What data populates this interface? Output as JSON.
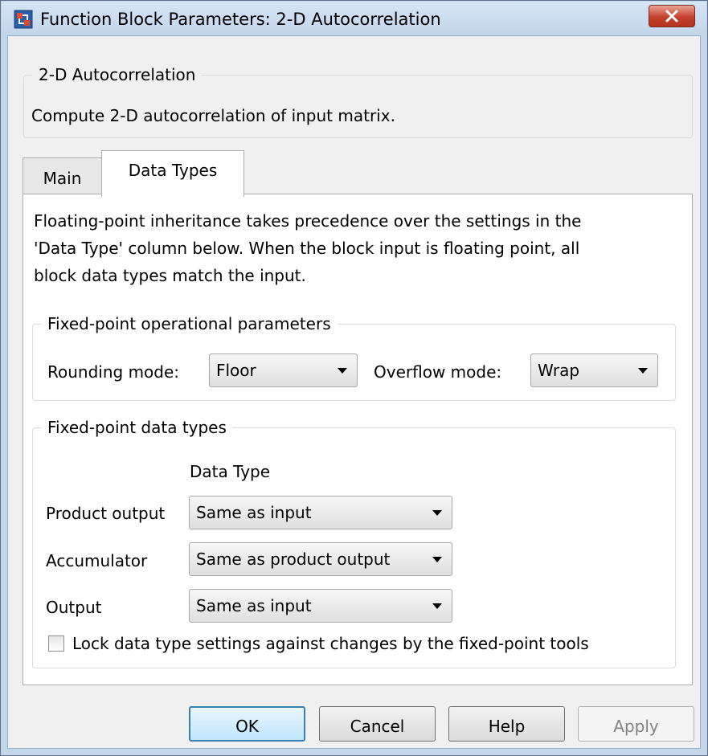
{
  "window": {
    "title": "Function Block Parameters: 2-D Autocorrelation"
  },
  "description": {
    "group_title": "2-D Autocorrelation",
    "text": "Compute 2-D autocorrelation of input matrix."
  },
  "tabs": [
    {
      "label": "Main",
      "selected": false
    },
    {
      "label": "Data Types",
      "selected": true
    }
  ],
  "data_types": {
    "intro_lines": [
      "Floating-point inheritance takes precedence over the settings in the",
      "'Data Type' column below. When the block input is floating point, all",
      "block data types match the input."
    ],
    "operational": {
      "group_title": "Fixed-point operational parameters",
      "rounding_label": "Rounding mode:",
      "rounding_value": "Floor",
      "overflow_label": "Overflow mode:",
      "overflow_value": "Wrap"
    },
    "fixed_point_types": {
      "group_title": "Fixed-point data types",
      "column_header": "Data Type",
      "rows": [
        {
          "label": "Product output",
          "value": "Same as input"
        },
        {
          "label": "Accumulator",
          "value": "Same as product output"
        },
        {
          "label": "Output",
          "value": "Same as input"
        }
      ],
      "lock_checkbox_label": "Lock data type settings against changes by the fixed-point tools",
      "lock_checked": false
    }
  },
  "buttons": {
    "ok": "OK",
    "cancel": "Cancel",
    "help": "Help",
    "apply": "Apply",
    "apply_enabled": false
  },
  "colors": {
    "title_bar": "#c4d6ea",
    "close_button": "#c5402c",
    "default_button_border": "#3c7fb1"
  }
}
